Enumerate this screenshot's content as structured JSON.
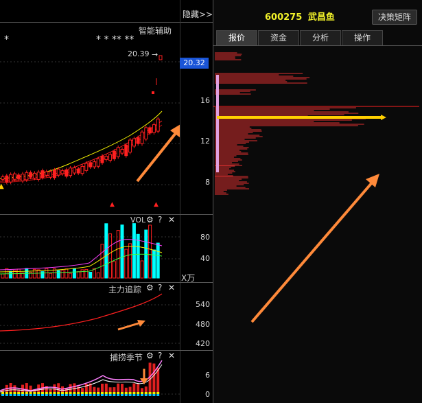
{
  "left_header": {
    "hide_label": "隐藏>>"
  },
  "main_panel": {
    "title": "智能辅助",
    "stars": "* *  ** **",
    "left_star": "*",
    "last_price_text": "20.39",
    "price_tag": "20.32"
  },
  "price_axis": {
    "ticks": [
      "16",
      "12",
      "8"
    ]
  },
  "vol_panel": {
    "title": "VOL",
    "ticks": [
      "80",
      "40"
    ],
    "unit": "X万"
  },
  "main_force_panel": {
    "title": "主力追踪",
    "ticks": [
      "540",
      "480",
      "420"
    ]
  },
  "season_panel": {
    "title": "捕捞季节",
    "ticks": [
      "6",
      "0"
    ]
  },
  "right_header": {
    "stock_code": "600275",
    "stock_name": "武昌鱼",
    "matrix_button": "决策矩阵"
  },
  "tabs": [
    {
      "label": "报价",
      "active": true
    },
    {
      "label": "资金",
      "active": false
    },
    {
      "label": "分析",
      "active": false
    },
    {
      "label": "操作",
      "active": false
    }
  ],
  "colors": {
    "up": "#ff3030",
    "accent": "#ffd000",
    "volume_cyan": "#00ffff",
    "arrow": "#ff8a3a",
    "price_tag_bg": "#1a55d8"
  },
  "icons": {
    "gear": "gear-icon",
    "help": "help-icon",
    "close": "close-icon"
  }
}
